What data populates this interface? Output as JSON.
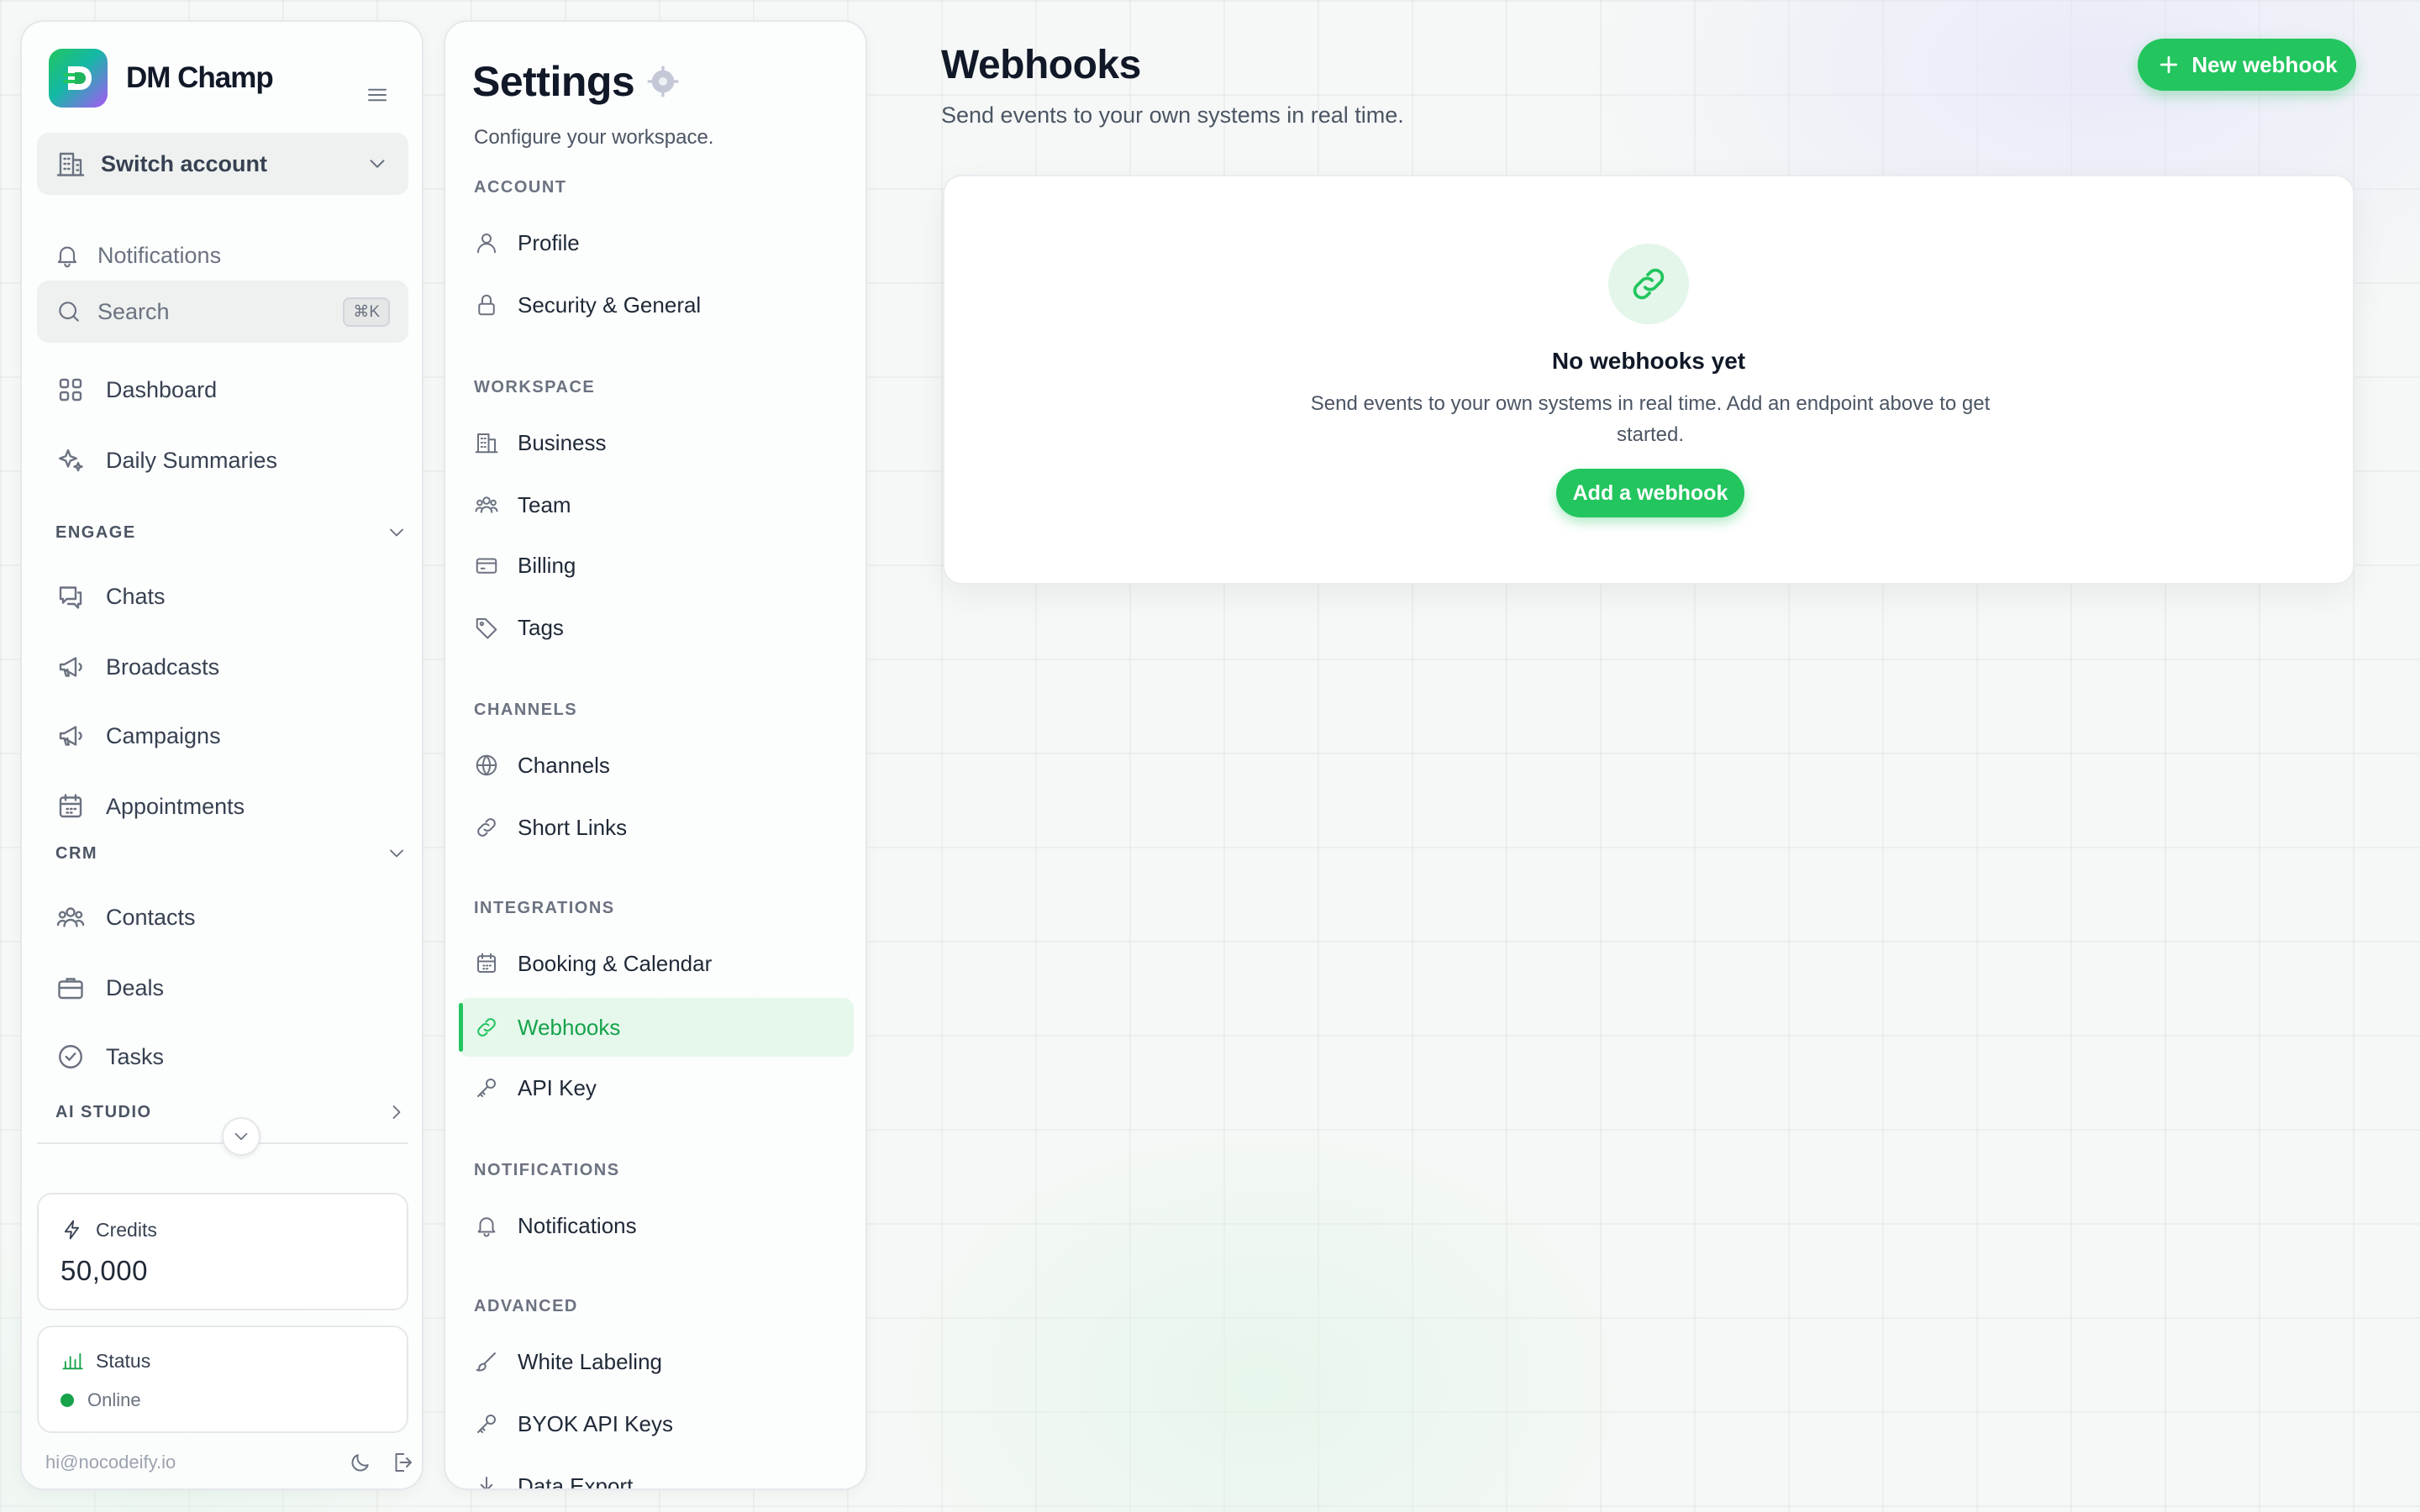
{
  "app": {
    "brand": "DM Champ"
  },
  "sidebar": {
    "switch_account": "Switch account",
    "notifications": "Notifications",
    "search_placeholder": "Search",
    "search_shortcut": "⌘K",
    "top_items": [
      {
        "label": "Dashboard",
        "icon": "grid-icon"
      },
      {
        "label": "Daily Summaries",
        "icon": "sparkles-icon"
      }
    ],
    "sections": {
      "engage": {
        "title": "ENGAGE",
        "items": [
          "Chats",
          "Broadcasts",
          "Campaigns",
          "Appointments"
        ]
      },
      "crm": {
        "title": "CRM",
        "items": [
          "Contacts",
          "Deals",
          "Tasks"
        ]
      },
      "ai_studio": {
        "title": "AI STUDIO"
      }
    },
    "credits": {
      "label": "Credits",
      "value": "50,000"
    },
    "status": {
      "label": "Status",
      "value": "Online"
    },
    "user_email": "hi@nocodeify.io"
  },
  "settings": {
    "title": "Settings",
    "subtitle": "Configure your workspace.",
    "sections": [
      {
        "title": "ACCOUNT",
        "items": [
          "Profile",
          "Security & General"
        ]
      },
      {
        "title": "WORKSPACE",
        "items": [
          "Business",
          "Team",
          "Billing",
          "Tags"
        ]
      },
      {
        "title": "CHANNELS",
        "items": [
          "Channels",
          "Short Links"
        ]
      },
      {
        "title": "INTEGRATIONS",
        "items": [
          "Booking & Calendar",
          "Webhooks",
          "API Key"
        ]
      },
      {
        "title": "NOTIFICATIONS",
        "items": [
          "Notifications"
        ]
      },
      {
        "title": "ADVANCED",
        "items": [
          "White Labeling",
          "BYOK API Keys",
          "Data Export"
        ]
      }
    ],
    "active_item": "Webhooks"
  },
  "main": {
    "title": "Webhooks",
    "subtitle": "Send events to your own systems in real time.",
    "new_button": "New webhook",
    "empty": {
      "title": "No webhooks yet",
      "description": "Send events to your own systems in real time. Add an endpoint above to get started.",
      "button": "Add a webhook"
    }
  },
  "colors": {
    "accent": "#22c55e",
    "accent_dark": "#16a34a",
    "active_bg": "#e6f7ec"
  }
}
